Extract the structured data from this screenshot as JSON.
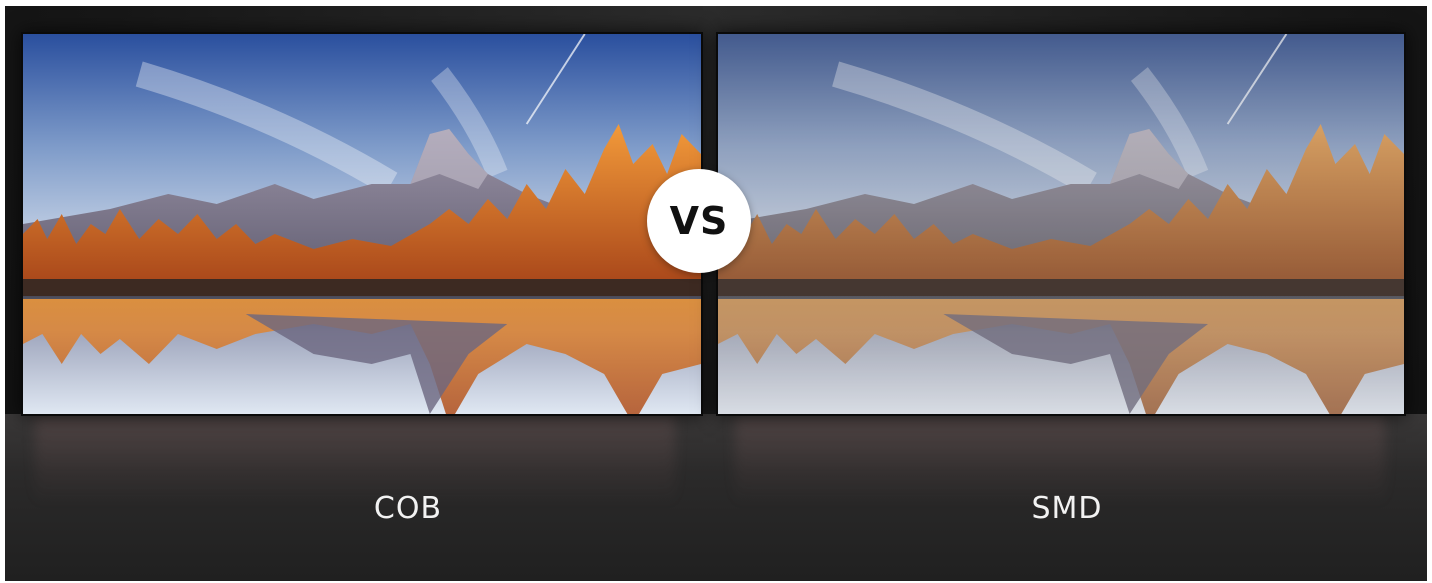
{
  "comparison": {
    "badge_text": "VS",
    "left": {
      "label": "COB"
    },
    "right": {
      "label": "SMD"
    }
  },
  "image": {
    "scene": "lake-mountain-reflection"
  },
  "colors": {
    "sky_top": "#2a4f9e",
    "sky_horizon": "#dfe6f0",
    "mountain": "#7e7890",
    "autumn_trees": "#e0742a",
    "badge_bg": "#ffffff",
    "label_text": "#f2f2f2"
  }
}
